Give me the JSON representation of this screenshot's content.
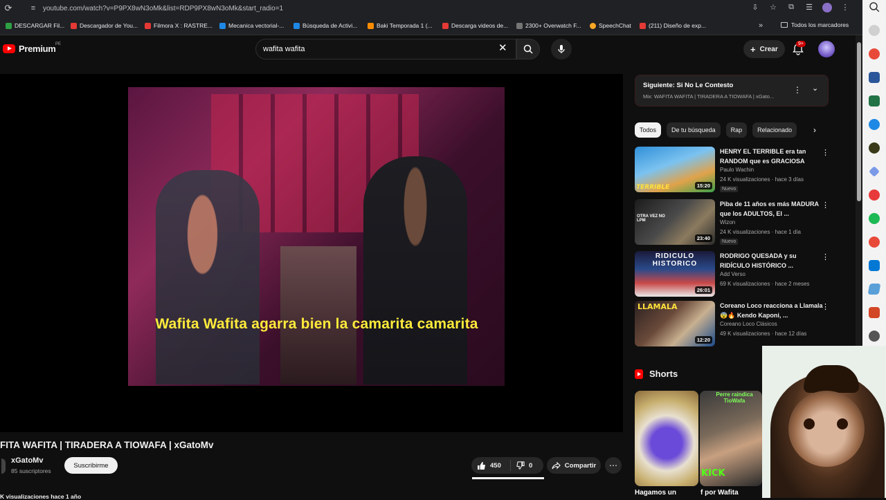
{
  "browser": {
    "url": "youtube.com/watch?v=P9PX8wN3oMk&list=RDP9PX8wN3oMk&start_radio=1",
    "bookmarks": [
      {
        "label": "DESCARGAR Fil...",
        "color": "#2ea043"
      },
      {
        "label": "Descargador de You...",
        "color": "#e53935"
      },
      {
        "label": "Filmora X : RASTRE...",
        "color": "#e53935"
      },
      {
        "label": "Mecanica vectorial-...",
        "color": "#1e88e5"
      },
      {
        "label": "Búsqueda de Activi...",
        "color": "#1e88e5"
      },
      {
        "label": "Baki Temporada 1 (...",
        "color": "#fb8c00"
      },
      {
        "label": "Descarga videos de...",
        "color": "#e53935"
      },
      {
        "label": "2300+ Overwatch F...",
        "color": "#757575"
      },
      {
        "label": "SpeechChat",
        "color": "#f9a825"
      },
      {
        "label": "(211) Diseño de exp...",
        "color": "#e53935"
      }
    ],
    "more_label": "»",
    "all_bookmarks_label": "Todos los marcadores"
  },
  "header": {
    "logo_text": "Premium",
    "region": "PE",
    "search_value": "wafita wafita",
    "create_label": "Crear",
    "notifications_badge": "9+"
  },
  "video": {
    "caption": "Wafita Wafita agarra bien la camarita camarita",
    "title": "FITA WAFITA | TIRADERA A TIOWAFA | xGatoMv",
    "channel": "xGatoMv",
    "subscribers": "85 suscriptores",
    "subscribe_label": "Suscribirme",
    "likes": "450",
    "dislikes": "0",
    "share_label": "Compartir",
    "views_line": "K visualizaciones  hace 1 año",
    "like_ratio": 1.0
  },
  "next": {
    "title": "Siguiente: Si No Le Contesto",
    "subtitle": "Mix: WAFITA WAFITA | TIRADERA A TIOWAFA | xGato..."
  },
  "chips": [
    "Todos",
    "De tu búsqueda",
    "Rap",
    "Relacionado"
  ],
  "recommendations": [
    {
      "title": "HENRY EL TERRIBLE era tan RANDOM que es GRACIOSA",
      "channel": "Paulo Wachin",
      "meta": "24 K visualizaciones · hace 3 días",
      "badge": "Nuevo",
      "duration": "15:20",
      "thumb_caption": "TERRIBLE"
    },
    {
      "title": "Piba de 11 años es más MADURA que los ADULTOS, El ...",
      "channel": "Wizon",
      "meta": "24 K visualizaciones · hace 1 día",
      "badge": "Nuevo",
      "duration": "23:40",
      "thumb_caption": "OTRA VEZ NO LPM"
    },
    {
      "title": "RODRIGO QUESADA y su RIDÍCULO HISTÓRICO ...",
      "channel": "Add Verso",
      "meta": "69 K visualizaciones · hace 2 meses",
      "badge": "",
      "duration": "26:01",
      "thumb_caption": "RIDICULO HISTORICO"
    },
    {
      "title": "Coreano Loco reacciona a Llamala 😨🔥 Kendo Kaponi, ...",
      "channel": "Coreano Loco Clásicos",
      "meta": "49 K visualizaciones · hace 12 días",
      "badge": "",
      "duration": "12:20",
      "thumb_caption": "LLAMALA"
    }
  ],
  "shorts": {
    "heading": "Shorts",
    "items": [
      {
        "caption": "Hagamos un",
        "overlay": ""
      },
      {
        "caption": "f por Wafita",
        "overlay": "Perre raindica TioWafa"
      }
    ],
    "kick_label": "KICK"
  },
  "colors": {
    "accent": "#ff0000",
    "caption": "#ffeb3b"
  }
}
